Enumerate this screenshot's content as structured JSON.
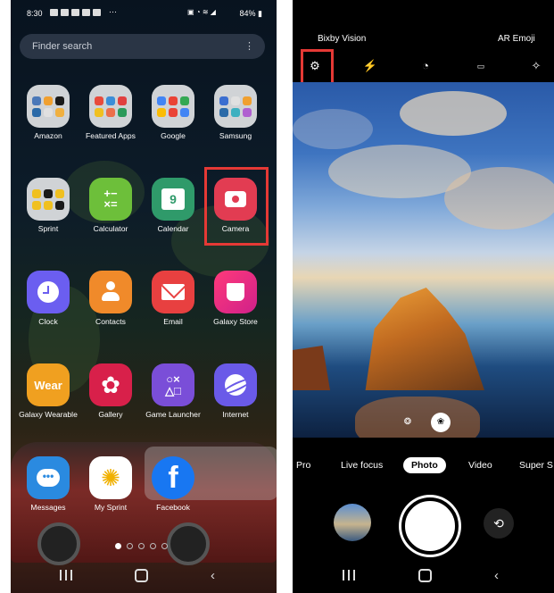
{
  "left_phone": {
    "status": {
      "time": "8:30",
      "battery": "84%"
    },
    "search_placeholder": "Finder search",
    "apps": [
      {
        "label": "Amazon",
        "icon": "folder-icon"
      },
      {
        "label": "Featured Apps",
        "icon": "folder-icon"
      },
      {
        "label": "Google",
        "icon": "folder-icon"
      },
      {
        "label": "Samsung",
        "icon": "folder-icon"
      },
      {
        "label": "Sprint",
        "icon": "folder-icon"
      },
      {
        "label": "Calculator",
        "icon": "calculator-icon"
      },
      {
        "label": "Calendar",
        "icon": "calendar-icon",
        "day": "9"
      },
      {
        "label": "Camera",
        "icon": "camera-icon"
      },
      {
        "label": "Clock",
        "icon": "clock-icon"
      },
      {
        "label": "Contacts",
        "icon": "contacts-icon"
      },
      {
        "label": "Email",
        "icon": "email-icon"
      },
      {
        "label": "Galaxy Store",
        "icon": "galaxy-store-icon"
      },
      {
        "label": "Galaxy Wearable",
        "icon": "wear-icon",
        "badge": "Wear"
      },
      {
        "label": "Gallery",
        "icon": "gallery-icon"
      },
      {
        "label": "Game Launcher",
        "icon": "game-launcher-icon"
      },
      {
        "label": "Internet",
        "icon": "internet-icon"
      },
      {
        "label": "Messages",
        "icon": "messages-icon"
      },
      {
        "label": "My Sprint",
        "icon": "sprint-icon"
      },
      {
        "label": "Facebook",
        "icon": "facebook-icon",
        "badge": "f"
      }
    ]
  },
  "right_phone": {
    "top_modes": {
      "left": "Bixby Vision",
      "right": "AR Emoji"
    },
    "modes": [
      "Pro",
      "Live focus",
      "Photo",
      "Video",
      "Super S"
    ],
    "active_mode": "Photo"
  }
}
